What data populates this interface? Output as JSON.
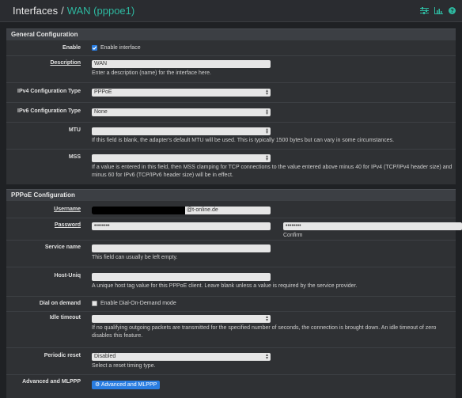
{
  "header": {
    "breadcrumb_root": "Interfaces",
    "separator": "/",
    "breadcrumb_current": "WAN (pppoe1)"
  },
  "general": {
    "title": "General Configuration",
    "enable_label": "Enable",
    "enable_checkbox_label": "Enable interface",
    "description_label": "Description",
    "description_value": "WAN",
    "description_help": "Enter a description (name) for the interface here.",
    "ipv4_label": "IPv4 Configuration Type",
    "ipv4_value": "PPPoE",
    "ipv6_label": "IPv6 Configuration Type",
    "ipv6_value": "None",
    "mtu_label": "MTU",
    "mtu_help": "If this field is blank, the adapter's default MTU will be used. This is typically 1500 bytes but can vary in some circumstances.",
    "mss_label": "MSS",
    "mss_help": "If a value is entered in this field, then MSS clamping for TCP connections to the value entered above minus 40 for IPv4 (TCP/IPv4 header size) and minus 60 for IPv6 (TCP/IPv6 header size) will be in effect."
  },
  "pppoe": {
    "title": "PPPoE Configuration",
    "username_label": "Username",
    "username_suffix": "@t-online.de",
    "password_label": "Password",
    "password_value": "••••••••",
    "confirm_value": "••••••••",
    "confirm_label": "Confirm",
    "service_label": "Service name",
    "service_help": "This field can usually be left empty.",
    "hostuniq_label": "Host-Uniq",
    "hostuniq_help": "A unique host tag value for this PPPoE client. Leave blank unless a value is required by the service provider.",
    "dialondemand_label": "Dial on demand",
    "dialondemand_checkbox_label": "Enable Dial-On-Demand mode",
    "idle_label": "Idle timeout",
    "idle_help": "If no qualifying outgoing packets are transmitted for the specified number of seconds, the connection is brought down. An idle timeout of zero disables this feature.",
    "periodic_label": "Periodic reset",
    "periodic_value": "Disabled",
    "periodic_help": "Select a reset timing type.",
    "advanced_label": "Advanced and MLPPP",
    "advanced_button": "Advanced and MLPPP"
  }
}
